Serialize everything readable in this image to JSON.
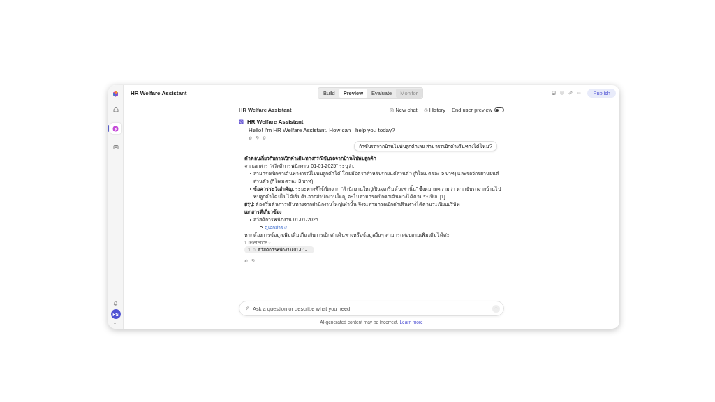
{
  "rail": {
    "items": [
      {
        "kind": "home",
        "selected": false
      },
      {
        "kind": "agent",
        "selected": true
      },
      {
        "kind": "library",
        "selected": false
      }
    ],
    "avatar": "PS",
    "more": "···"
  },
  "topbar": {
    "title": "HR Welfare Assistant",
    "tabs": [
      {
        "label": "Build",
        "selected": false,
        "disabled": false
      },
      {
        "label": "Preview",
        "selected": true,
        "disabled": false
      },
      {
        "label": "Evaluate",
        "selected": false,
        "disabled": false
      },
      {
        "label": "Monitor",
        "selected": false,
        "disabled": true
      }
    ],
    "publish": "Publish"
  },
  "chat_header": {
    "title": "HR Welfare Assistant",
    "new_chat": "New chat",
    "history": "History",
    "toggle": {
      "label": "End user preview",
      "on": false
    }
  },
  "messages": [
    {
      "kind": "greeting",
      "sender": "HR Welfare Assistant",
      "text": "Hello! I'm HR Welfare Assistant. How can I help you today?"
    },
    {
      "kind": "user",
      "text": "ถ้าขับรถจากบ้านไปพบลูกค้าเลย สามารถเบิกค่าเดินทางได้ไหม?"
    },
    {
      "kind": "answer",
      "blocks": [
        {
          "kind": "heading",
          "text": "คำตอบเกี่ยวกับการเบิกค่าเดินทางกรณีขับรถจากบ้านไปพบลูกค้า"
        },
        {
          "kind": "text",
          "text": "จากเอกสาร \"สวัสดิการพนักงาน 01-01-2025\" ระบุว่า:"
        },
        {
          "kind": "bullet",
          "text": "สามารถเบิกค่าเดินทางกรณีไปพบลูกค้าได้ โดยมีอัตราสำหรับรถยนต์ส่วนตัว (กิโลเมตรละ 5 บาท) และรถจักรยานยนต์ส่วนตัว (กิโลเมตรละ 3 บาท)"
        },
        {
          "kind": "bullet",
          "text": "**ข้อควรระวังสำคัญ:** ระยะทางที่ใช้เบิกจาก \"สำนักงานใหญ่เป็นจุดเริ่มต้นเท่านั้น\" ซึ่งหมายความว่า หากขับรถจากบ้านไปพบลูกค้าโดยไม่ได้เริ่มต้นจากสำนักงานใหญ่ จะไม่สามารถเบิกค่าเดินทางได้ตามระเบียบ [1]"
        },
        {
          "kind": "text",
          "text": "**สรุป:** ต้องเริ่มต้นการเดินทางจากสำนักงานใหญ่เท่านั้น จึงจะสามารถเบิกค่าเดินทางได้ตามระเบียบบริษัท"
        },
        {
          "kind": "heading",
          "text": "เอกสารที่เกี่ยวข้อง"
        },
        {
          "kind": "bullet",
          "text": "สวัสดิการพนักงาน 01-01-2025"
        },
        {
          "kind": "sublink",
          "text": "ดูเอกสาร"
        },
        {
          "kind": "text",
          "text": "หากต้องการข้อมูลเพิ่มเติมเกี่ยวกับการเบิกค่าเดินทางหรือข้อมูลอื่นๆ สามารถสอบถามเพิ่มเติมได้ค่ะ"
        }
      ],
      "references": {
        "label": "1 reference",
        "expanded": false,
        "items": [
          {
            "number": "1",
            "title": "สวัสดิการพนักงาน 01-01-..."
          }
        ]
      }
    }
  ],
  "composer": {
    "placeholder": "Ask a question or describe what you need"
  },
  "footer": {
    "text": "AI-generated content may be incorrect.",
    "link": "Learn more"
  }
}
